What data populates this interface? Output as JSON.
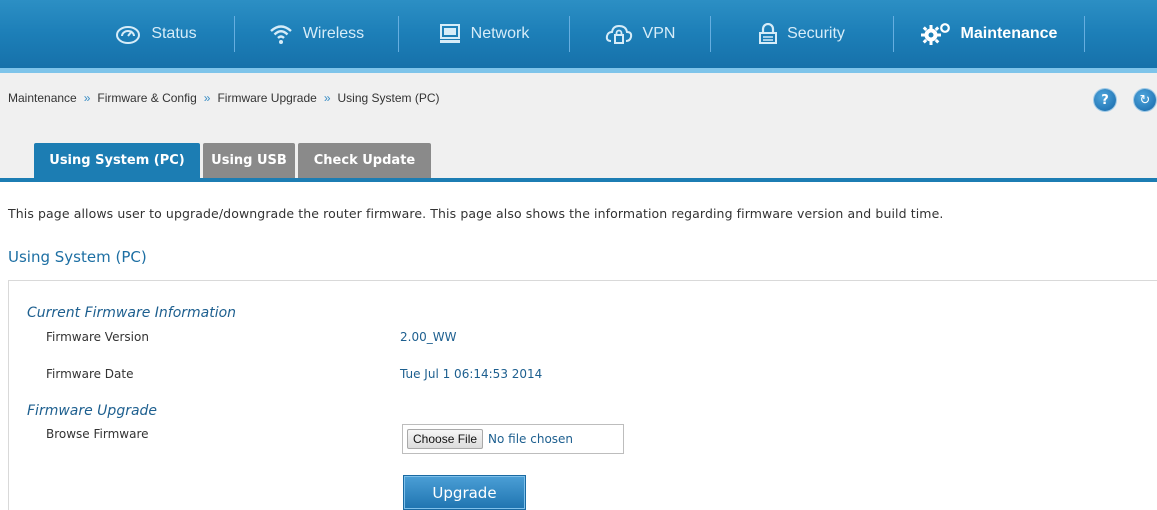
{
  "nav": {
    "items": [
      {
        "label": "Status",
        "icon": "speedometer-icon"
      },
      {
        "label": "Wireless",
        "icon": "wifi-icon"
      },
      {
        "label": "Network",
        "icon": "monitor-icon"
      },
      {
        "label": "VPN",
        "icon": "cloud-lock-icon"
      },
      {
        "label": "Security",
        "icon": "lock-icon"
      },
      {
        "label": "Maintenance",
        "icon": "gears-icon"
      }
    ],
    "active": "Maintenance"
  },
  "breadcrumb": {
    "items": [
      "Maintenance",
      "Firmware & Config",
      "Firmware Upgrade",
      "Using System (PC)"
    ],
    "separator": "»"
  },
  "header_icons": {
    "help": "?",
    "refresh": "↻"
  },
  "tabs": [
    {
      "label": "Using System (PC)",
      "active": true
    },
    {
      "label": "Using USB",
      "active": false
    },
    {
      "label": "Check Update",
      "active": false
    }
  ],
  "description": "This page allows user to upgrade/downgrade the router firmware. This page also shows the information regarding firmware version and build time.",
  "section_title": "Using System (PC)",
  "current_firmware": {
    "title": "Current Firmware Information",
    "version_label": "Firmware Version",
    "version_value": "2.00_WW",
    "date_label": "Firmware Date",
    "date_value": "Tue Jul 1 06:14:53 2014"
  },
  "firmware_upgrade": {
    "title": "Firmware Upgrade",
    "browse_label": "Browse Firmware",
    "choose_file_label": "Choose File",
    "file_status": "No file chosen",
    "upgrade_label": "Upgrade"
  },
  "colors": {
    "accent": "#1c7db3",
    "nav_bg": "#1d7fb8",
    "tab_inactive": "#8a8a8a"
  }
}
